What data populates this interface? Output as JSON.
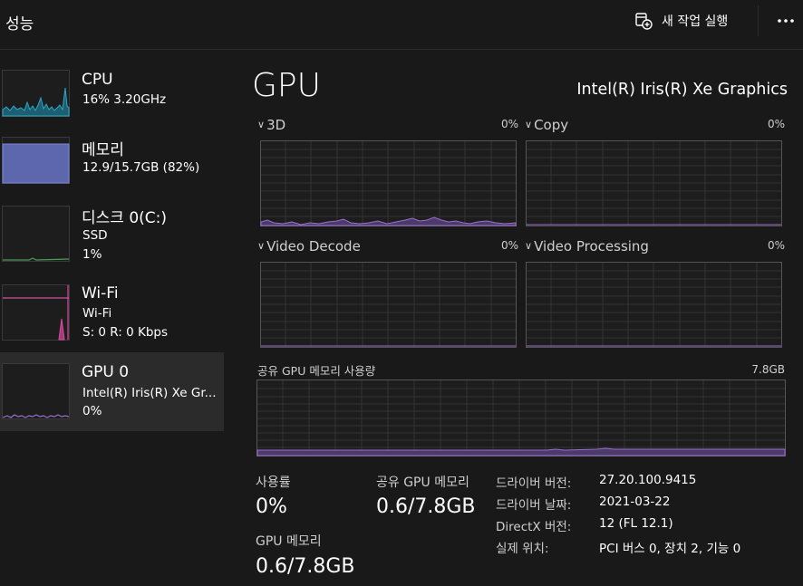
{
  "header": {
    "title": "성능",
    "run_task_label": "새 작업 실행",
    "more_icon": "more-icon"
  },
  "sidebar": {
    "items": [
      {
        "name": "CPU",
        "line1": "16% 3.20GHz",
        "line2": "",
        "color": "#2ea8c6",
        "icon": "cpu-graph-thumbnail"
      },
      {
        "name": "메모리",
        "line1": "12.9/15.7GB (82%)",
        "line2": "",
        "color": "#6673c7",
        "icon": "memory-graph-thumbnail"
      },
      {
        "name": "디스크 0(C:)",
        "line1": "SSD",
        "line2": "1%",
        "color": "#4d9a5a",
        "icon": "disk-graph-thumbnail"
      },
      {
        "name": "Wi-Fi",
        "line1": "Wi-Fi",
        "line2": "S: 0 R: 0 Kbps",
        "color": "#d64f9c",
        "icon": "wifi-graph-thumbnail"
      },
      {
        "name": "GPU 0",
        "line1": "Intel(R) Iris(R) Xe Gr...",
        "line2": "0%",
        "color": "#9a6fce",
        "icon": "gpu-graph-thumbnail",
        "selected": true
      }
    ]
  },
  "main": {
    "title": "GPU",
    "adapter": "Intel(R) Iris(R) Xe Graphics",
    "graphs": [
      {
        "label": "3D",
        "percent": "0%"
      },
      {
        "label": "Copy",
        "percent": "0%"
      },
      {
        "label": "Video Decode",
        "percent": "0%"
      },
      {
        "label": "Video Processing",
        "percent": "0%"
      }
    ],
    "shared_memory": {
      "label": "공유 GPU 메모리 사용량",
      "max": "7.8GB"
    },
    "stats": {
      "utilization_label": "사용률",
      "utilization_value": "0%",
      "shared_mem_label": "공유 GPU 메모리",
      "shared_mem_value": "0.6/7.8GB",
      "gpu_mem_label": "GPU 메모리",
      "gpu_mem_value": "0.6/7.8GB"
    },
    "info": [
      {
        "key": "드라이버 버전:",
        "value": "27.20.100.9415"
      },
      {
        "key": "드라이버 날짜:",
        "value": "2021-03-22"
      },
      {
        "key": "DirectX 버전:",
        "value": "12 (FL 12.1)"
      },
      {
        "key": "실제 위치:",
        "value": "PCI 버스 0, 장치 2, 기능 0"
      }
    ]
  },
  "colors": {
    "background": "#191919",
    "gpu_accent": "#9a6fce",
    "grid": "#3a3a3a"
  }
}
